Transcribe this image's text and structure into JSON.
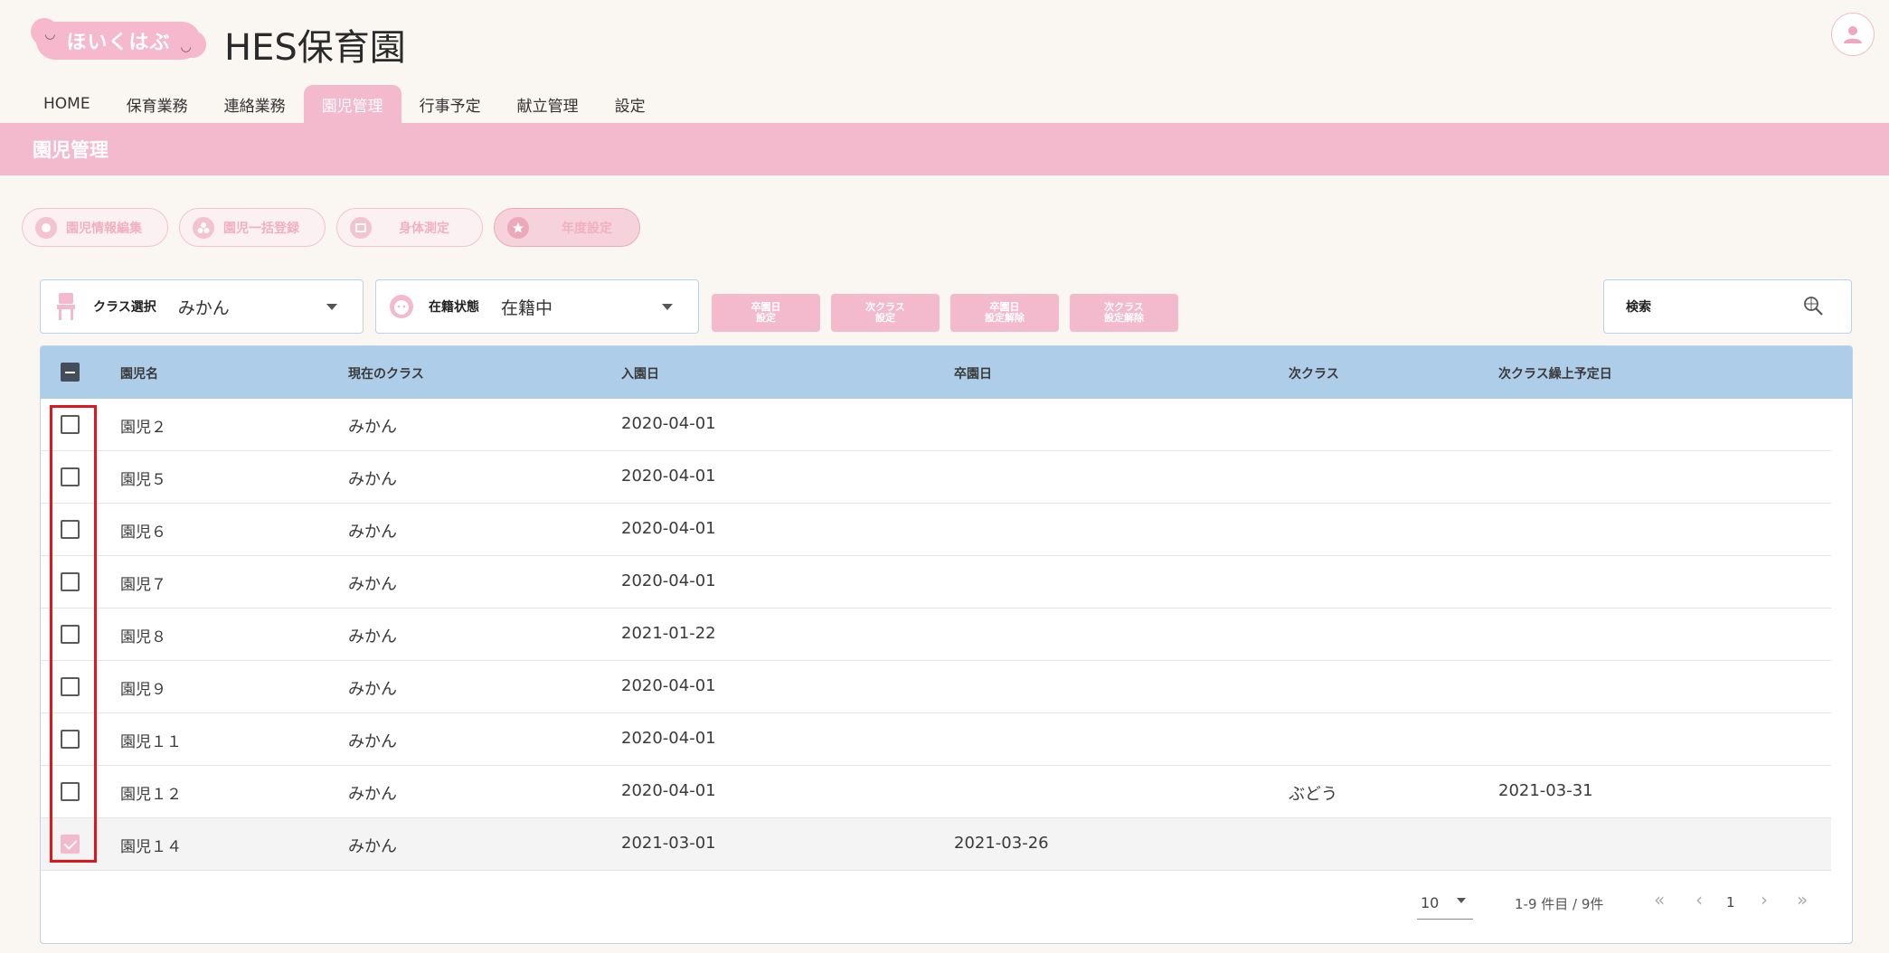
{
  "header": {
    "logo_text": "ほいくはぶ",
    "site_title": "HES保育園"
  },
  "nav": {
    "tabs": [
      {
        "label": "HOME"
      },
      {
        "label": "保育業務"
      },
      {
        "label": "連絡業務"
      },
      {
        "label": "園児管理",
        "active": true
      },
      {
        "label": "行事予定"
      },
      {
        "label": "献立管理"
      },
      {
        "label": "設定"
      }
    ]
  },
  "page_title": "園児管理",
  "subnav": [
    {
      "label": "園児情報編集",
      "icon": "child-face-icon"
    },
    {
      "label": "園児一括登録",
      "icon": "group-icon"
    },
    {
      "label": "身体測定",
      "icon": "ruler-icon"
    },
    {
      "label": "年度設定",
      "icon": "star-icon",
      "active": true
    }
  ],
  "filters": {
    "class_select": {
      "label": "クラス選択",
      "value": "みかん"
    },
    "status_select": {
      "label": "在籍状態",
      "value": "在籍中"
    },
    "search": {
      "label": "検索"
    }
  },
  "actions": [
    {
      "line1": "卒園日",
      "line2": "設定"
    },
    {
      "line1": "次クラス",
      "line2": "設定"
    },
    {
      "line1": "卒園日",
      "line2": "設定解除"
    },
    {
      "line1": "次クラス",
      "line2": "設定解除"
    }
  ],
  "table": {
    "columns": [
      "園児名",
      "現在のクラス",
      "入園日",
      "卒園日",
      "次クラス",
      "次クラス繰上予定日"
    ],
    "rows": [
      {
        "name": "園児２",
        "class": "みかん",
        "entry": "2020-04-01",
        "grad": "",
        "next_class": "",
        "next_date": "",
        "checked": false
      },
      {
        "name": "園児５",
        "class": "みかん",
        "entry": "2020-04-01",
        "grad": "",
        "next_class": "",
        "next_date": "",
        "checked": false
      },
      {
        "name": "園児６",
        "class": "みかん",
        "entry": "2020-04-01",
        "grad": "",
        "next_class": "",
        "next_date": "",
        "checked": false
      },
      {
        "name": "園児７",
        "class": "みかん",
        "entry": "2020-04-01",
        "grad": "",
        "next_class": "",
        "next_date": "",
        "checked": false
      },
      {
        "name": "園児８",
        "class": "みかん",
        "entry": "2021-01-22",
        "grad": "",
        "next_class": "",
        "next_date": "",
        "checked": false
      },
      {
        "name": "園児９",
        "class": "みかん",
        "entry": "2020-04-01",
        "grad": "",
        "next_class": "",
        "next_date": "",
        "checked": false
      },
      {
        "name": "園児１１",
        "class": "みかん",
        "entry": "2020-04-01",
        "grad": "",
        "next_class": "",
        "next_date": "",
        "checked": false
      },
      {
        "name": "園児１２",
        "class": "みかん",
        "entry": "2020-04-01",
        "grad": "",
        "next_class": "ぶどう",
        "next_date": "2021-03-31",
        "checked": false
      },
      {
        "name": "園児１４",
        "class": "みかん",
        "entry": "2021-03-01",
        "grad": "2021-03-26",
        "next_class": "",
        "next_date": "",
        "checked": true
      }
    ]
  },
  "pagination": {
    "per_page": "10",
    "range_text": "1-9 件目 / 9件",
    "current_page": "1"
  },
  "colors": {
    "accent_pink": "#f3b9cc",
    "header_blue": "#aecde8",
    "highlight_red": "#e0161c"
  }
}
